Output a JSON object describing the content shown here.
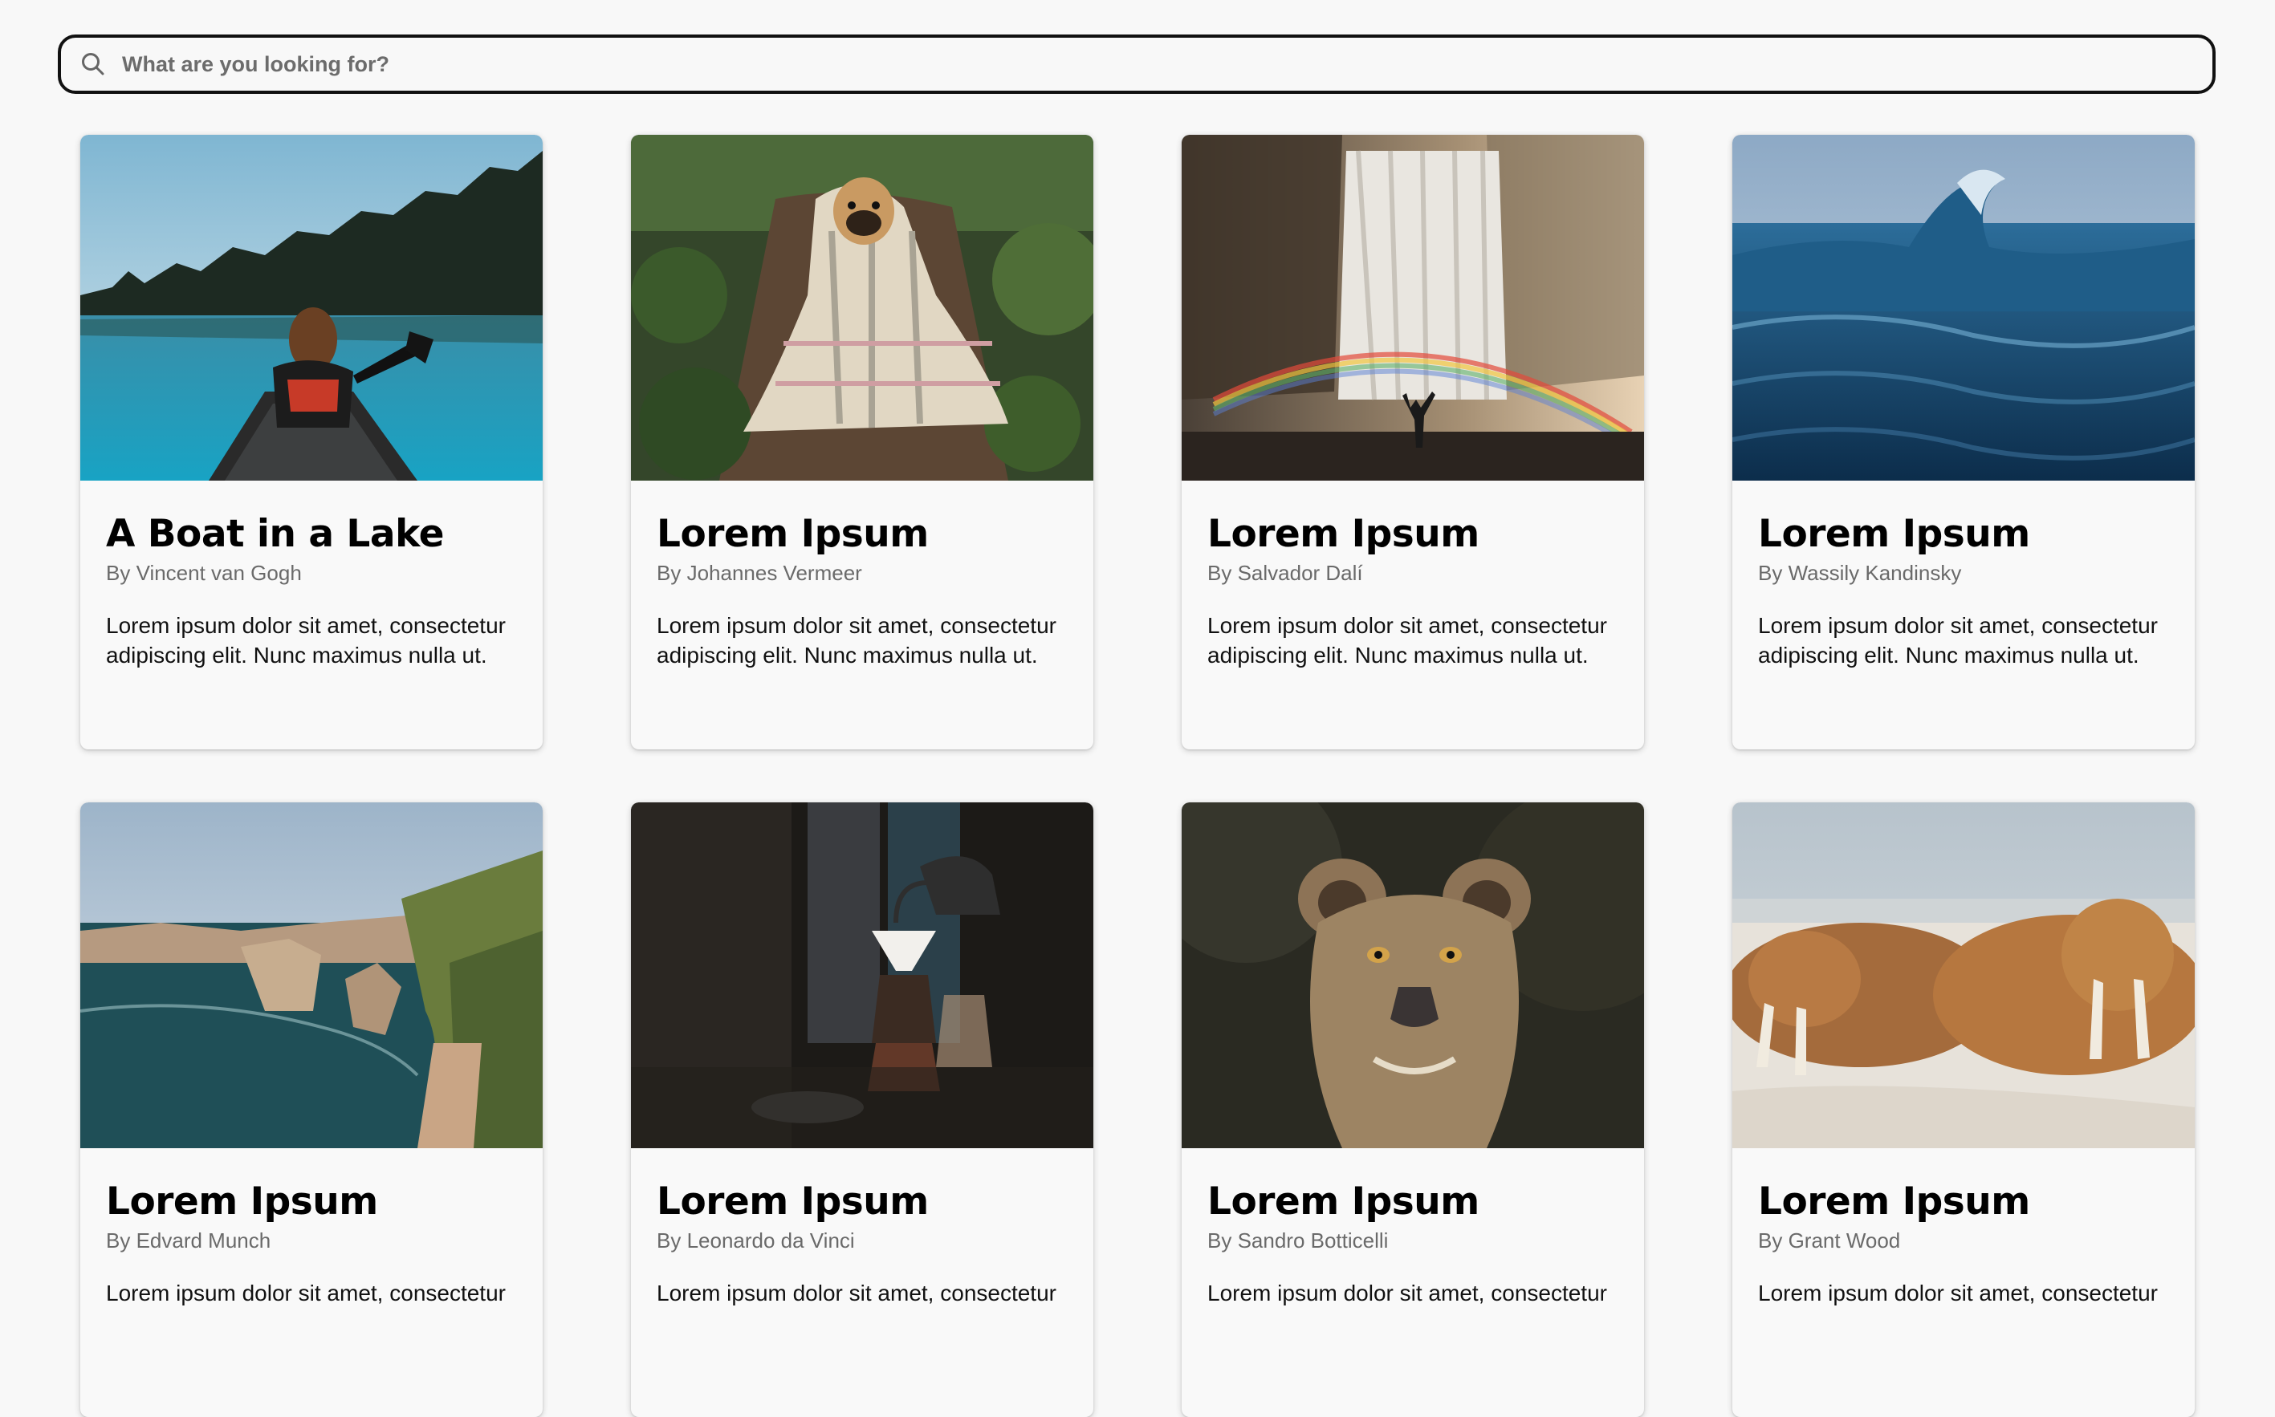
{
  "search": {
    "placeholder": "What are you looking for?",
    "value": ""
  },
  "cards": [
    {
      "title": "A Boat in a Lake",
      "author": "By Vincent van Gogh",
      "description": "Lorem ipsum dolor sit amet, consectetur adipiscing elit. Nunc maximus nulla ut.",
      "image": "woman-in-canoe-on-lake"
    },
    {
      "title": "Lorem Ipsum",
      "author": "By Johannes Vermeer",
      "description": "Lorem ipsum dolor sit amet, consectetur adipiscing elit. Nunc maximus nulla ut.",
      "image": "pug-in-blanket"
    },
    {
      "title": "Lorem Ipsum",
      "author": "By Salvador Dalí",
      "description": "Lorem ipsum dolor sit amet, consectetur adipiscing elit. Nunc maximus nulla ut.",
      "image": "waterfall-with-rainbow"
    },
    {
      "title": "Lorem Ipsum",
      "author": "By Wassily Kandinsky",
      "description": "Lorem ipsum dolor sit amet, consectetur adipiscing elit. Nunc maximus nulla ut.",
      "image": "ocean-wave"
    },
    {
      "title": "Lorem Ipsum",
      "author": "By Edvard Munch",
      "description": "Lorem ipsum dolor sit amet, consectetur",
      "image": "coastal-cliffs"
    },
    {
      "title": "Lorem Ipsum",
      "author": "By Leonardo da Vinci",
      "description": "Lorem ipsum dolor sit amet, consectetur",
      "image": "pour-over-coffee"
    },
    {
      "title": "Lorem Ipsum",
      "author": "By Sandro Botticelli",
      "description": "Lorem ipsum dolor sit amet, consectetur",
      "image": "lioness-portrait"
    },
    {
      "title": "Lorem Ipsum",
      "author": "By Grant Wood",
      "description": "Lorem ipsum dolor sit amet, consectetur",
      "image": "walruses-on-beach"
    }
  ]
}
